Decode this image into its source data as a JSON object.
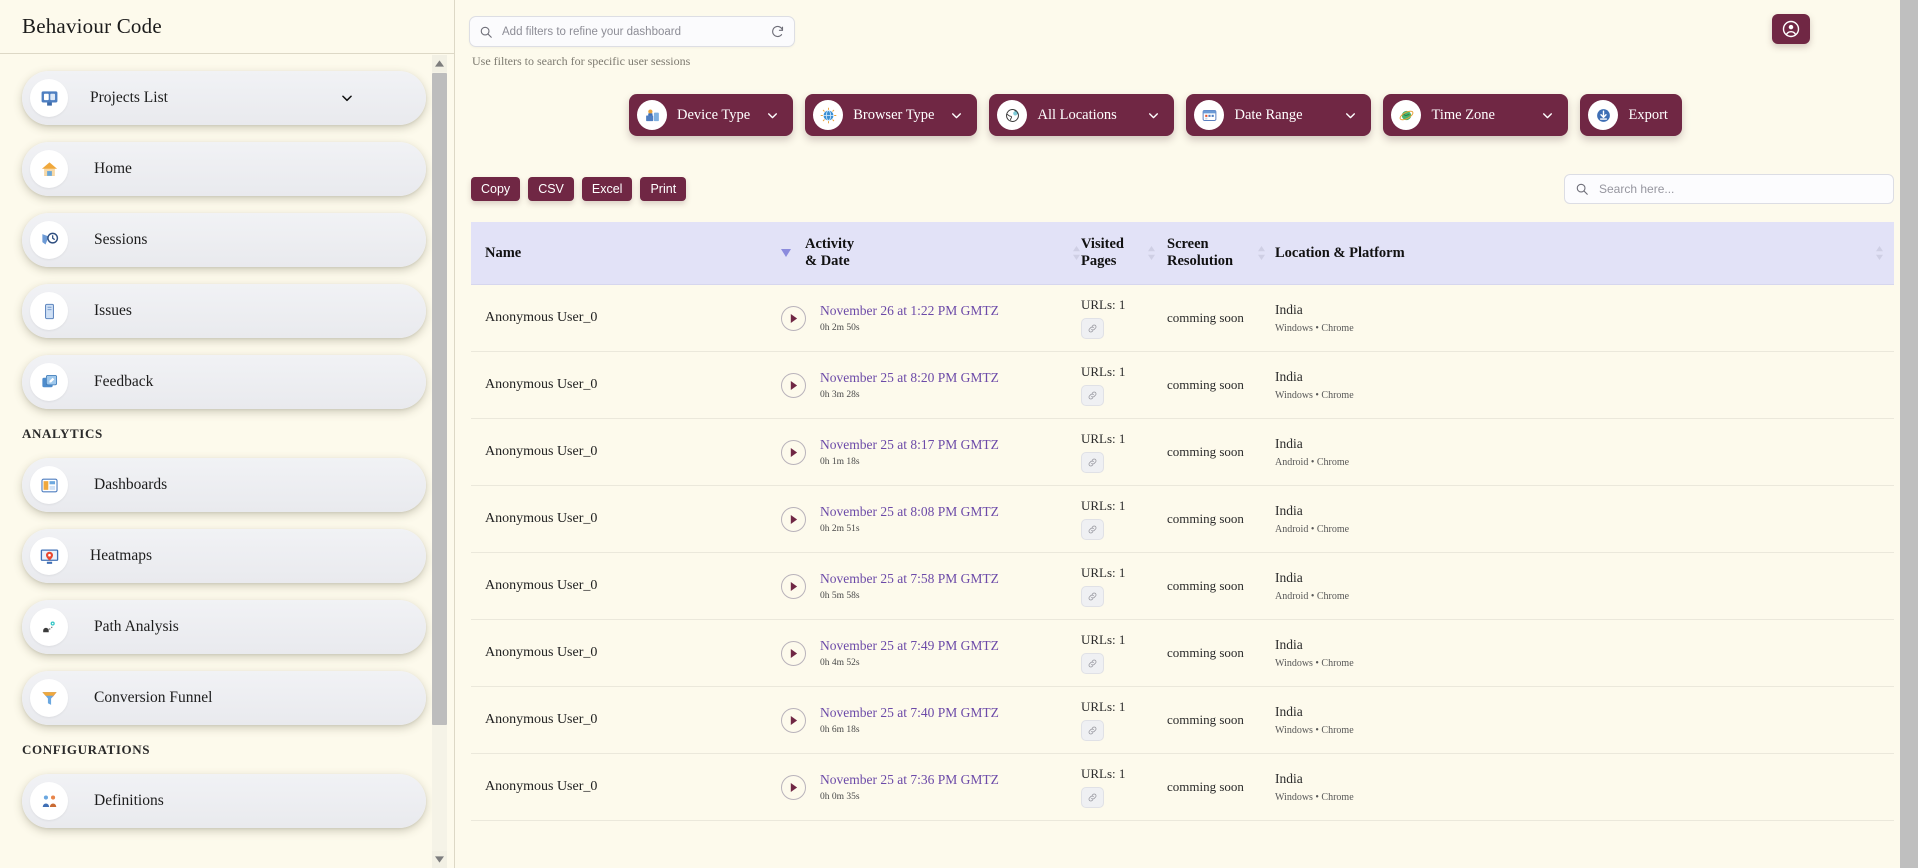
{
  "app": {
    "brand": "Behaviour Code"
  },
  "sidebar": {
    "items": [
      {
        "label": "Projects List",
        "icon": "projects-list-icon",
        "glyph": "🗂",
        "has_chevron": true
      },
      {
        "label": "Home",
        "icon": "home-icon",
        "glyph": "🏠",
        "has_chevron": false
      },
      {
        "label": "Sessions",
        "icon": "sessions-icon",
        "glyph": "🕸",
        "has_chevron": false
      },
      {
        "label": "Issues",
        "icon": "issues-icon",
        "glyph": "📓",
        "has_chevron": false
      },
      {
        "label": "Feedback",
        "icon": "feedback-icon",
        "glyph": "📬",
        "has_chevron": false
      }
    ],
    "section_analytics": "ANALYTICS",
    "analytics_items": [
      {
        "label": "Dashboards",
        "icon": "dashboards-icon",
        "glyph": "📊"
      },
      {
        "label": "Heatmaps",
        "icon": "heatmaps-icon",
        "glyph": "🖥"
      },
      {
        "label": "Path Analysis",
        "icon": "path-analysis-icon",
        "glyph": "👣"
      },
      {
        "label": "Conversion Funnel",
        "icon": "conversion-funnel-icon",
        "glyph": "🔻"
      }
    ],
    "section_configurations": "CONFIGURATIONS",
    "config_items": [
      {
        "label": "Definitions",
        "icon": "definitions-icon",
        "glyph": "👥"
      }
    ]
  },
  "topbar": {
    "filter_placeholder": "Add filters to refine your dashboard",
    "filter_value": "",
    "refresh_icon": "refresh-icon",
    "hint": "Use filters to search for specific user sessions",
    "avatar_icon": "user-account-icon"
  },
  "filters": [
    {
      "label": "Device Type",
      "icon": "device-type-icon",
      "glyph": "🖨",
      "chevron": true
    },
    {
      "label": "Browser Type",
      "icon": "browser-type-icon",
      "glyph": "🌐",
      "chevron": true
    },
    {
      "label": "All Locations",
      "icon": "locations-icon",
      "glyph": "🌍",
      "chevron": true
    },
    {
      "label": "Date Range",
      "icon": "date-range-icon",
      "glyph": "📅",
      "chevron": true
    },
    {
      "label": "Time Zone",
      "icon": "time-zone-icon",
      "glyph": "🌏",
      "chevron": true
    },
    {
      "label": "Export",
      "icon": "export-icon",
      "glyph": "⬇",
      "chevron": false
    }
  ],
  "toolbar": {
    "export_buttons": [
      "Copy",
      "CSV",
      "Excel",
      "Print"
    ],
    "search_placeholder": "Search here...",
    "search_value": ""
  },
  "table": {
    "columns": [
      {
        "label": "Name",
        "sortable": true
      },
      {
        "label": "Activity & Date",
        "sortable": true
      },
      {
        "label": "Visited Pages",
        "sortable": true
      },
      {
        "label": "Screen Resolution",
        "sortable": true
      },
      {
        "label": "Location & Platform",
        "sortable": true
      }
    ],
    "rows": [
      {
        "name": "Anonymous User_0",
        "date": "November 26 at 1:22 PM GMTZ",
        "duration": "0h 2m 50s",
        "urls": "URLs: 1",
        "resolution": "comming soon",
        "country": "India",
        "platform": "Windows • Chrome"
      },
      {
        "name": "Anonymous User_0",
        "date": "November 25 at 8:20 PM GMTZ",
        "duration": "0h 3m 28s",
        "urls": "URLs: 1",
        "resolution": "comming soon",
        "country": "India",
        "platform": "Windows • Chrome"
      },
      {
        "name": "Anonymous User_0",
        "date": "November 25 at 8:17 PM GMTZ",
        "duration": "0h 1m 18s",
        "urls": "URLs: 1",
        "resolution": "comming soon",
        "country": "India",
        "platform": "Android • Chrome"
      },
      {
        "name": "Anonymous User_0",
        "date": "November 25 at 8:08 PM GMTZ",
        "duration": "0h 2m 51s",
        "urls": "URLs: 1",
        "resolution": "comming soon",
        "country": "India",
        "platform": "Android • Chrome"
      },
      {
        "name": "Anonymous User_0",
        "date": "November 25 at 7:58 PM GMTZ",
        "duration": "0h 5m 58s",
        "urls": "URLs: 1",
        "resolution": "comming soon",
        "country": "India",
        "platform": "Android • Chrome"
      },
      {
        "name": "Anonymous User_0",
        "date": "November 25 at 7:49 PM GMTZ",
        "duration": "0h 4m 52s",
        "urls": "URLs: 1",
        "resolution": "comming soon",
        "country": "India",
        "platform": "Windows • Chrome"
      },
      {
        "name": "Anonymous User_0",
        "date": "November 25 at 7:40 PM GMTZ",
        "duration": "0h 6m 18s",
        "urls": "URLs: 1",
        "resolution": "comming soon",
        "country": "India",
        "platform": "Windows • Chrome"
      },
      {
        "name": "Anonymous User_0",
        "date": "November 25 at 7:36 PM GMTZ",
        "duration": "0h 0m 35s",
        "urls": "URLs: 1",
        "resolution": "comming soon",
        "country": "India",
        "platform": "Windows • Chrome"
      }
    ]
  },
  "colors": {
    "accent": "#702744",
    "page_bg": "#fdfaec",
    "table_header_bg": "#e2e2f7",
    "link": "#6c4aa8",
    "nav_item_bg": "#eceef2"
  }
}
